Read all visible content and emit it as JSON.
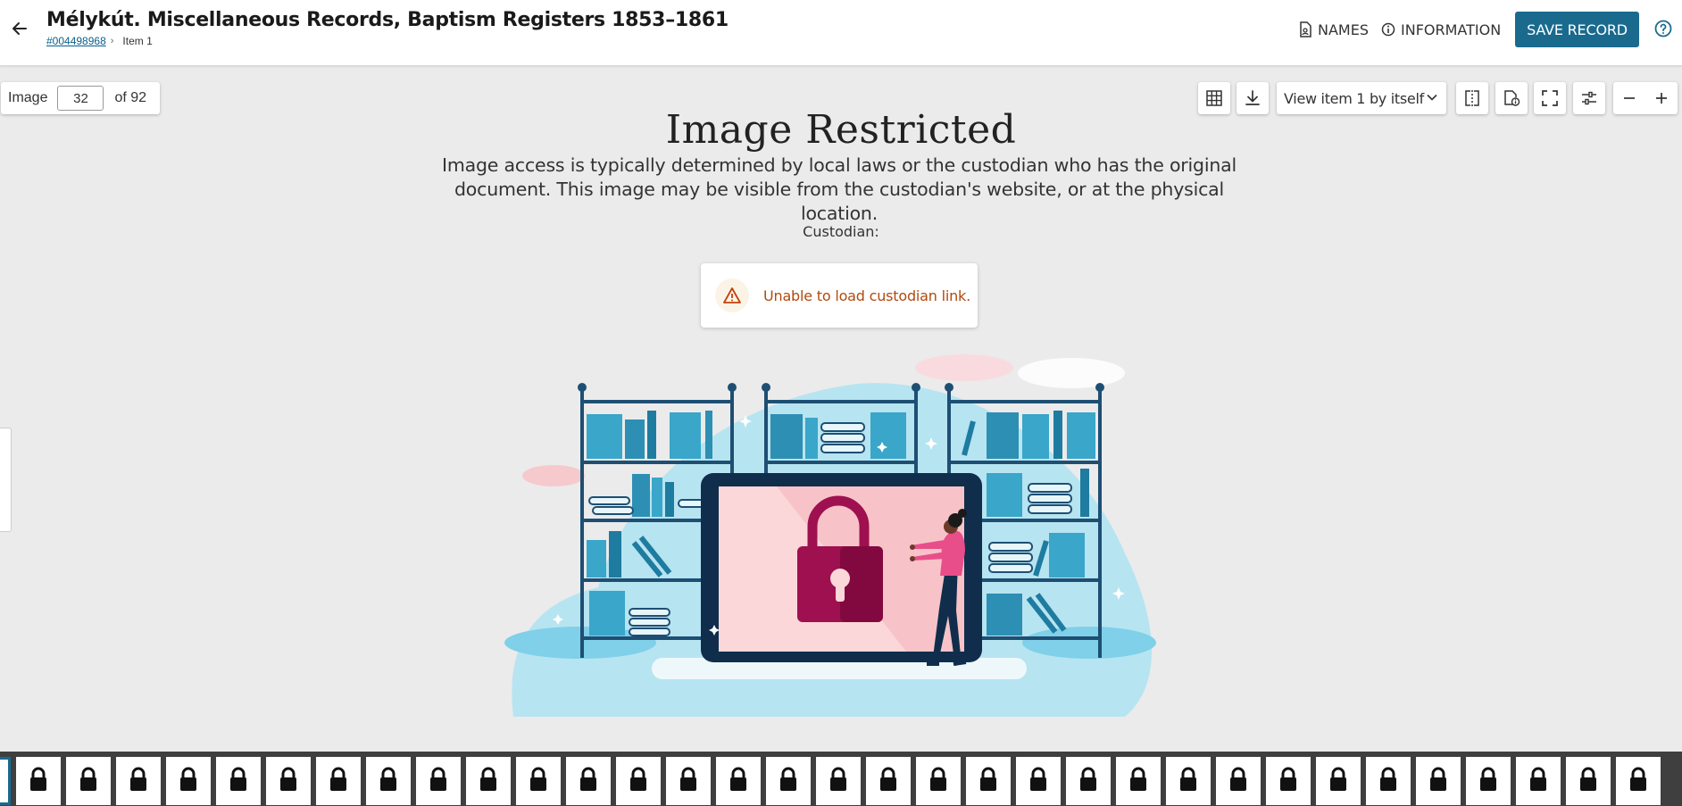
{
  "header": {
    "title": "Mélykút. Miscellaneous Records, Baptism Registers 1853–1861",
    "film_number": "#004498968",
    "item": "Item 1",
    "names_label": "NAMES",
    "information_label": "INFORMATION",
    "save_label": "SAVE RECORD"
  },
  "image_nav": {
    "label": "Image",
    "current": "32",
    "total_label": "of 92"
  },
  "toolbar": {
    "view_select": "View item 1 by itself"
  },
  "main": {
    "title": "Image Restricted",
    "description": "Image access is typically determined by local laws or the custodian who has the original document. This image may be visible from the custodian's website, or at the physical location.",
    "custodian_label": "Custodian:",
    "alert_text": "Unable to load custodian link."
  },
  "colors": {
    "accent": "#1a6a8e",
    "alert_text": "#b04a0e",
    "lock": "#9e1050"
  }
}
